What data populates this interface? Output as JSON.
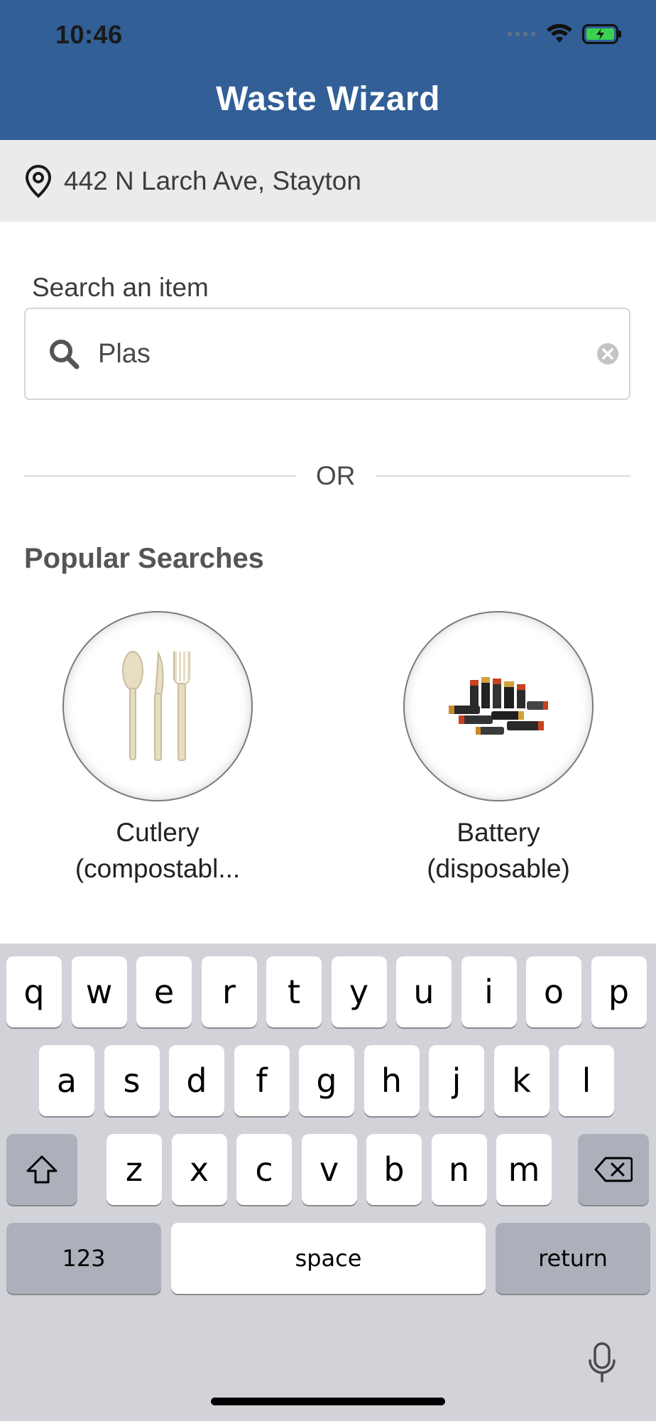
{
  "status_bar": {
    "time": "10:46"
  },
  "header": {
    "title": "Waste Wizard"
  },
  "location": {
    "address": "442 N Larch Ave, Stayton"
  },
  "search": {
    "label": "Search an item",
    "value": "Plas"
  },
  "divider": {
    "text": "OR"
  },
  "popular": {
    "title": "Popular Searches",
    "items": [
      {
        "line1": "Cutlery",
        "line2": "(compostabl..."
      },
      {
        "line1": "Battery",
        "line2": "(disposable)"
      }
    ]
  },
  "keyboard": {
    "row1": [
      "q",
      "w",
      "e",
      "r",
      "t",
      "y",
      "u",
      "i",
      "o",
      "p"
    ],
    "row2": [
      "a",
      "s",
      "d",
      "f",
      "g",
      "h",
      "j",
      "k",
      "l"
    ],
    "row3": [
      "z",
      "x",
      "c",
      "v",
      "b",
      "n",
      "m"
    ],
    "numbers_label": "123",
    "space_label": "space",
    "return_label": "return"
  },
  "colors": {
    "header": "#315f96",
    "keyboard_bg": "#d1d3d9"
  }
}
